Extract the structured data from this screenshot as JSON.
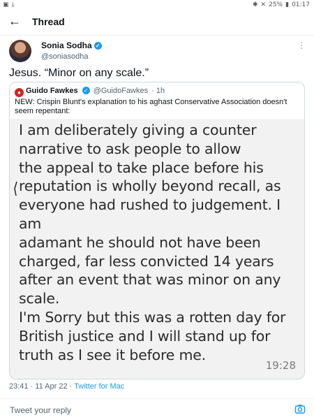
{
  "statusbar": {
    "battery": "25%",
    "time": "01:17"
  },
  "header": {
    "title": "Thread"
  },
  "tweet": {
    "name": "Sonia Sodha",
    "handle": "@soniasodha",
    "text": "Jesus. “Minor on any scale.”",
    "timestamp": "23:41 · 11 Apr 22 · ",
    "client": "Twitter for Mac"
  },
  "quote": {
    "name": "Guido Fawkes",
    "handle": "@GuidoFawkes",
    "age": "· 1h",
    "text": "NEW: Crispin Blunt's explanation to his aghast Conservative Association doesn't seem repentant:",
    "image_lines": [
      "I am deliberately giving a counter",
      "narrative to ask people to allow",
      "the appeal to take place before his",
      "reputation is wholly beyond recall, as",
      "everyone had rushed to judgement. I",
      "am",
      "adamant he should not have been",
      "charged, far less convicted 14 years",
      "after an event that was minor on any",
      "scale.",
      "I'm Sorry but this was a rotten day for",
      "British justice and I will stand up for",
      "truth as I see it before me."
    ],
    "image_time": "19:28"
  },
  "reply": {
    "placeholder": "Tweet your reply"
  },
  "colors": {
    "accent": "#1d9bf0",
    "text": "#0f1419",
    "secondary": "#536471"
  }
}
